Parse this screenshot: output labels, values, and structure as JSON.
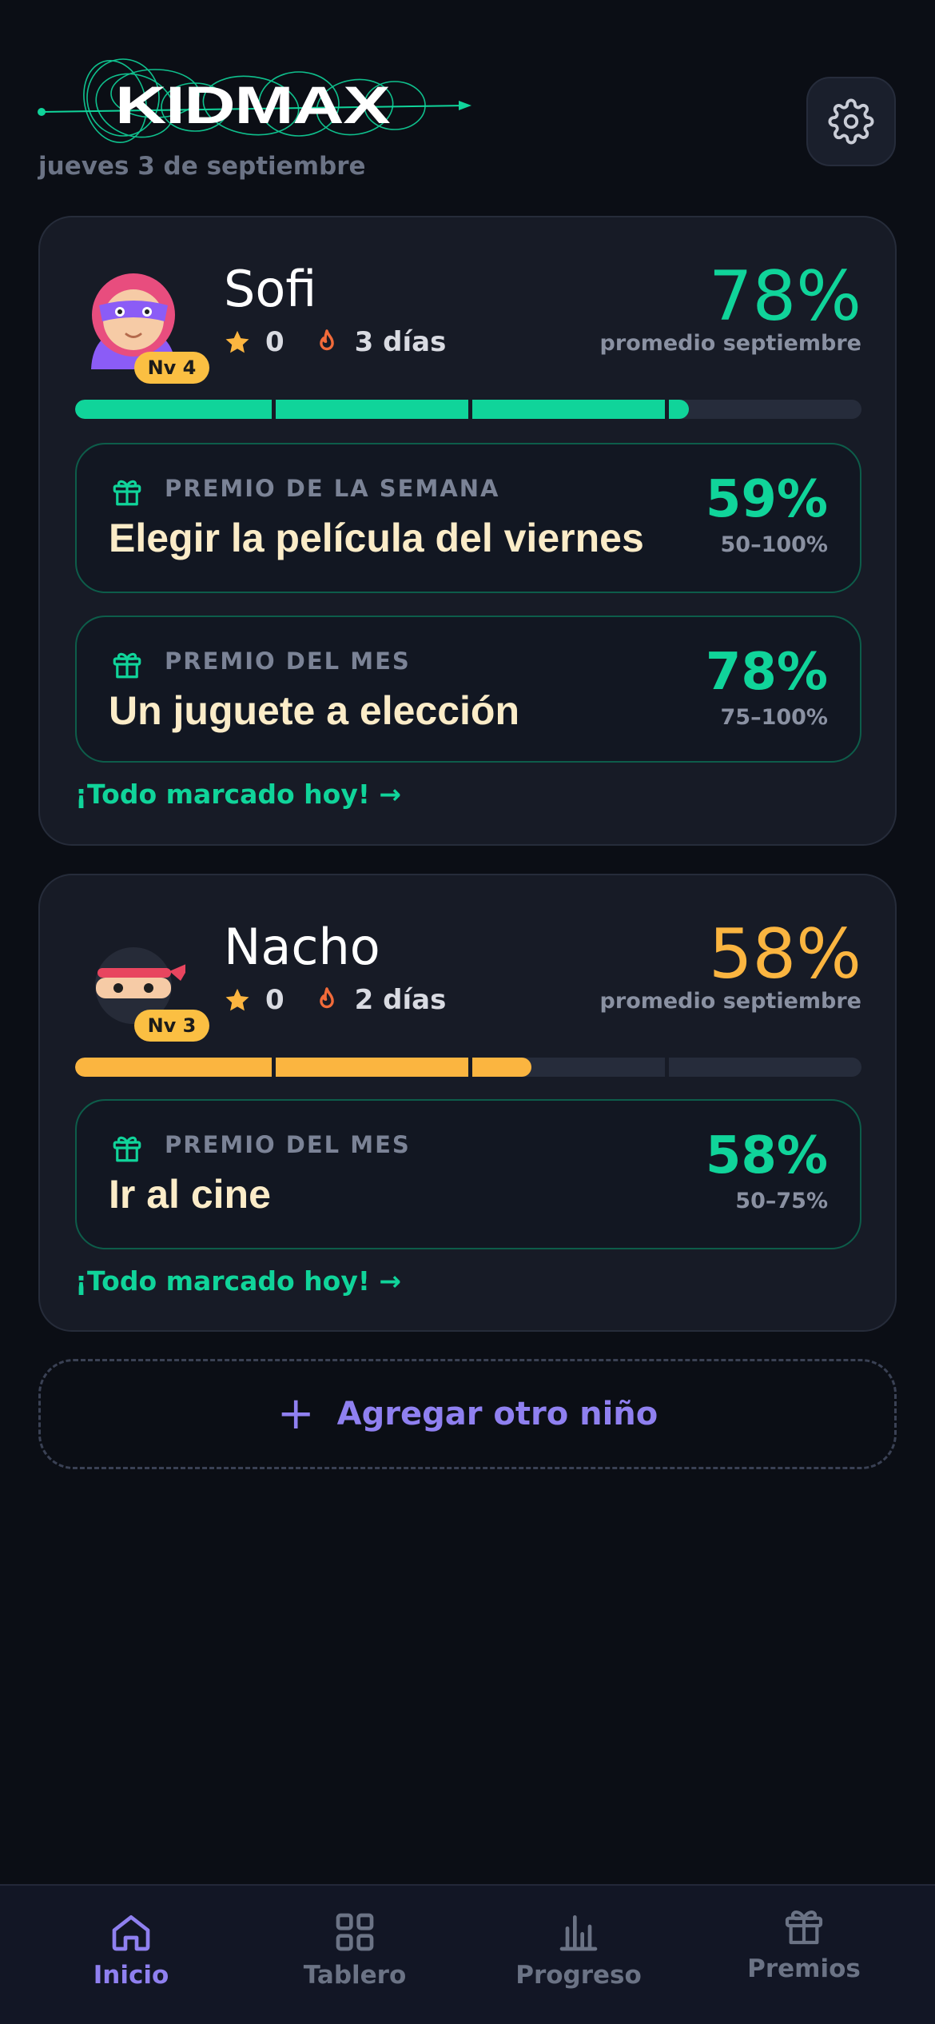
{
  "app": {
    "logo_text": "KIDMAX",
    "date": "jueves 3 de septiembre"
  },
  "icons": {
    "settings": "gear-icon",
    "star": "star-icon",
    "streak": "flame-icon",
    "gift": "gift-icon",
    "add": "plus-icon"
  },
  "colors": {
    "green": "#10d49a",
    "amber": "#fbb540",
    "purple": "#8f80f0",
    "background": "#0b0e15",
    "card": "#171b26"
  },
  "children": [
    {
      "name": "Sofi",
      "level": "Nv 4",
      "stars": "0",
      "streak": "3 días",
      "average_pct": "78%",
      "average_caption": "promedio septiembre",
      "progress": 0.78,
      "prizes": [
        {
          "label": "PREMIO DE LA SEMANA",
          "title": "Elegir la película del viernes",
          "pct": "59%",
          "range": "50–100%"
        },
        {
          "label": "PREMIO DEL MES",
          "title": "Un juguete a elección",
          "pct": "78%",
          "range": "75–100%"
        }
      ],
      "all_done": "¡Todo marcado hoy! →"
    },
    {
      "name": "Nacho",
      "level": "Nv 3",
      "stars": "0",
      "streak": "2 días",
      "average_pct": "58%",
      "average_caption": "promedio septiembre",
      "progress": 0.58,
      "prizes": [
        {
          "label": "PREMIO DEL MES",
          "title": "Ir al cine",
          "pct": "58%",
          "range": "50–75%"
        }
      ],
      "all_done": "¡Todo marcado hoy! →"
    }
  ],
  "add_child": {
    "plus": "+",
    "label": "Agregar otro niño"
  },
  "nav": [
    {
      "label": "Inicio",
      "icon": "home-icon",
      "active": true
    },
    {
      "label": "Tablero",
      "icon": "grid-icon",
      "active": false
    },
    {
      "label": "Progreso",
      "icon": "bar-chart-icon",
      "active": false
    },
    {
      "label": "Premios",
      "icon": "gift-icon",
      "active": false
    }
  ]
}
